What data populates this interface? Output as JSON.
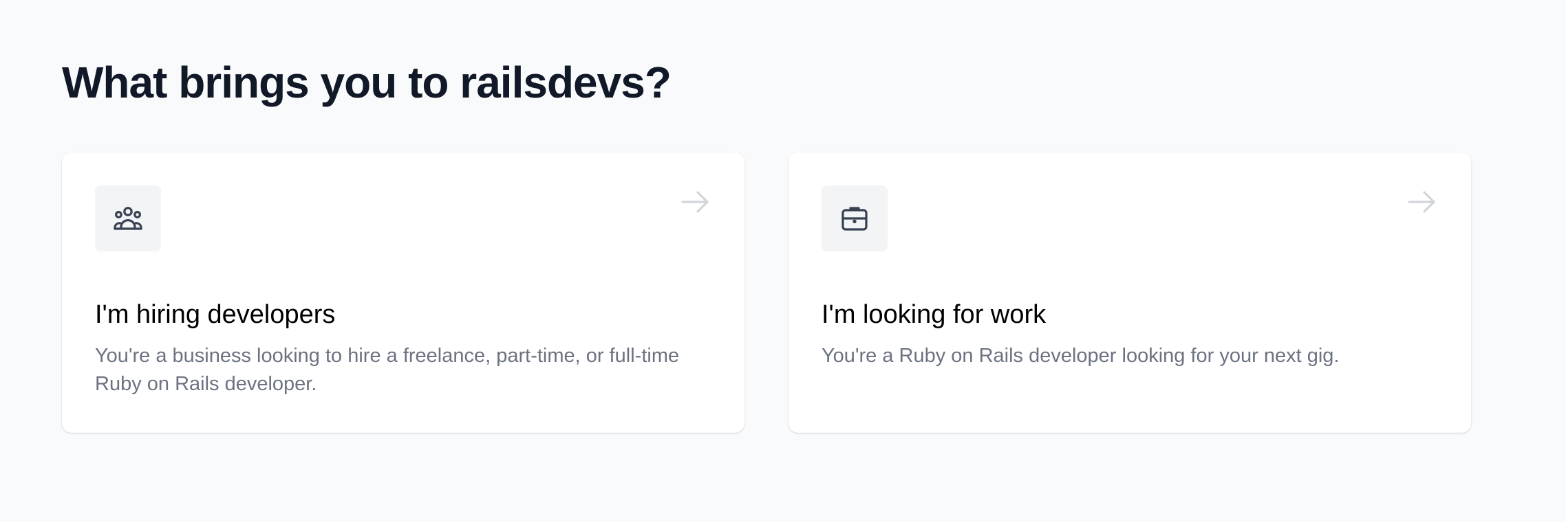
{
  "page": {
    "title": "What brings you to railsdevs?"
  },
  "options": [
    {
      "icon": "user-group-icon",
      "title": "I'm hiring developers",
      "description": "You're a business looking to hire a freelance, part-time, or full-time Ruby on Rails developer."
    },
    {
      "icon": "briefcase-icon",
      "title": "I'm looking for work",
      "description": "You're a Ruby on Rails developer looking for your next gig."
    }
  ],
  "colors": {
    "background": "#f9fafb",
    "card": "#ffffff",
    "icon_box": "#f3f4f6",
    "icon": "#374151",
    "arrow": "#d1d5db",
    "title": "#111827",
    "description": "#6b7280"
  }
}
